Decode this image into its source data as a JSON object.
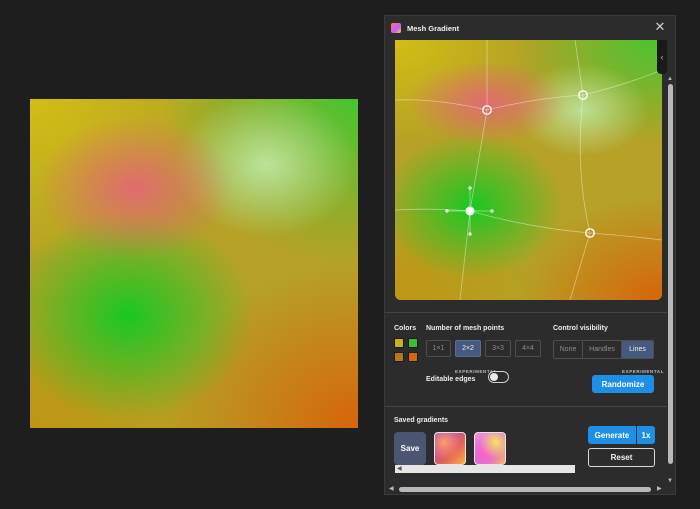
{
  "panel": {
    "title": "Mesh Gradient",
    "icon": "mesh-gradient-plugin-icon",
    "close_icon": "close-icon",
    "collapse_icon": "chevron-left-icon"
  },
  "colors": {
    "label": "Colors",
    "swatches": [
      "#c9b21a",
      "#3fbf2f",
      "#b5771f",
      "#d2650e"
    ]
  },
  "mesh_points": {
    "label": "Number of mesh points",
    "options": [
      "1×1",
      "2×2",
      "3×3",
      "4×4"
    ],
    "selected": "2×2"
  },
  "control_visibility": {
    "label": "Control visibility",
    "options": [
      "None",
      "Handles",
      "Lines"
    ],
    "selected": "Lines"
  },
  "editable_edges": {
    "tag": "EXPERIMENTAL",
    "label": "Editable edges",
    "enabled": false
  },
  "randomize": {
    "tag": "EXPERIMENTAL",
    "label": "Randomize"
  },
  "saved": {
    "label": "Saved gradients",
    "save_label": "Save"
  },
  "actions": {
    "generate_label": "Generate",
    "scale_label": "1x",
    "reset_label": "Reset"
  },
  "theme": {
    "accent": "#1e8fe6",
    "selected_segment": "#46597e",
    "panel_bg": "#2c2c2c",
    "page_bg": "#1e1e1e"
  }
}
